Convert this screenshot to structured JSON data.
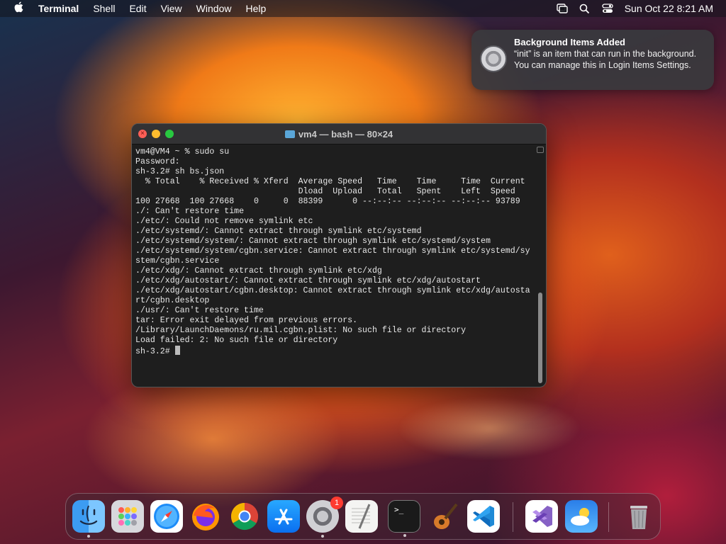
{
  "menubar": {
    "apple": "",
    "app": "Terminal",
    "items": [
      "Shell",
      "Edit",
      "View",
      "Window",
      "Help"
    ],
    "datetime": "Sun Oct 22  8:21 AM"
  },
  "notification": {
    "title": "Background Items Added",
    "body": "“init” is an item that can run in the background. You can manage this in Login Items Settings."
  },
  "terminal": {
    "title": "vm4 — bash — 80×24",
    "lines": [
      "vm4@VM4 ~ % sudo su",
      "Password:",
      "sh-3.2# sh bs.json",
      "  % Total    % Received % Xferd  Average Speed   Time    Time     Time  Current",
      "                                 Dload  Upload   Total   Spent    Left  Speed",
      "100 27668  100 27668    0     0  88399      0 --:--:-- --:--:-- --:--:-- 93789",
      "./: Can't restore time",
      "./etc/: Could not remove symlink etc",
      "./etc/systemd/: Cannot extract through symlink etc/systemd",
      "./etc/systemd/system/: Cannot extract through symlink etc/systemd/system",
      "./etc/systemd/system/cgbn.service: Cannot extract through symlink etc/systemd/sy",
      "stem/cgbn.service",
      "./etc/xdg/: Cannot extract through symlink etc/xdg",
      "./etc/xdg/autostart/: Cannot extract through symlink etc/xdg/autostart",
      "./etc/xdg/autostart/cgbn.desktop: Cannot extract through symlink etc/xdg/autosta",
      "rt/cgbn.desktop",
      "./usr/: Can't restore time",
      "tar: Error exit delayed from previous errors.",
      "/Library/LaunchDaemons/ru.mil.cgbn.plist: No such file or directory",
      "Load failed: 2: No such file or directory",
      "sh-3.2# "
    ]
  },
  "dock": {
    "settings_badge": "1",
    "items": [
      "finder-icon",
      "launchpad-icon",
      "safari-icon",
      "firefox-icon",
      "chrome-icon",
      "app-store-icon",
      "system-settings-icon",
      "textedit-icon",
      "terminal-icon",
      "garageband-icon",
      "vscode-icon",
      "visual-studio-icon",
      "weather-icon",
      "trash-icon"
    ]
  },
  "colors": {
    "terminal_bg": "#1e1e1e",
    "close": "#fe5f57",
    "minimize": "#febc2e",
    "zoom": "#28c840"
  }
}
